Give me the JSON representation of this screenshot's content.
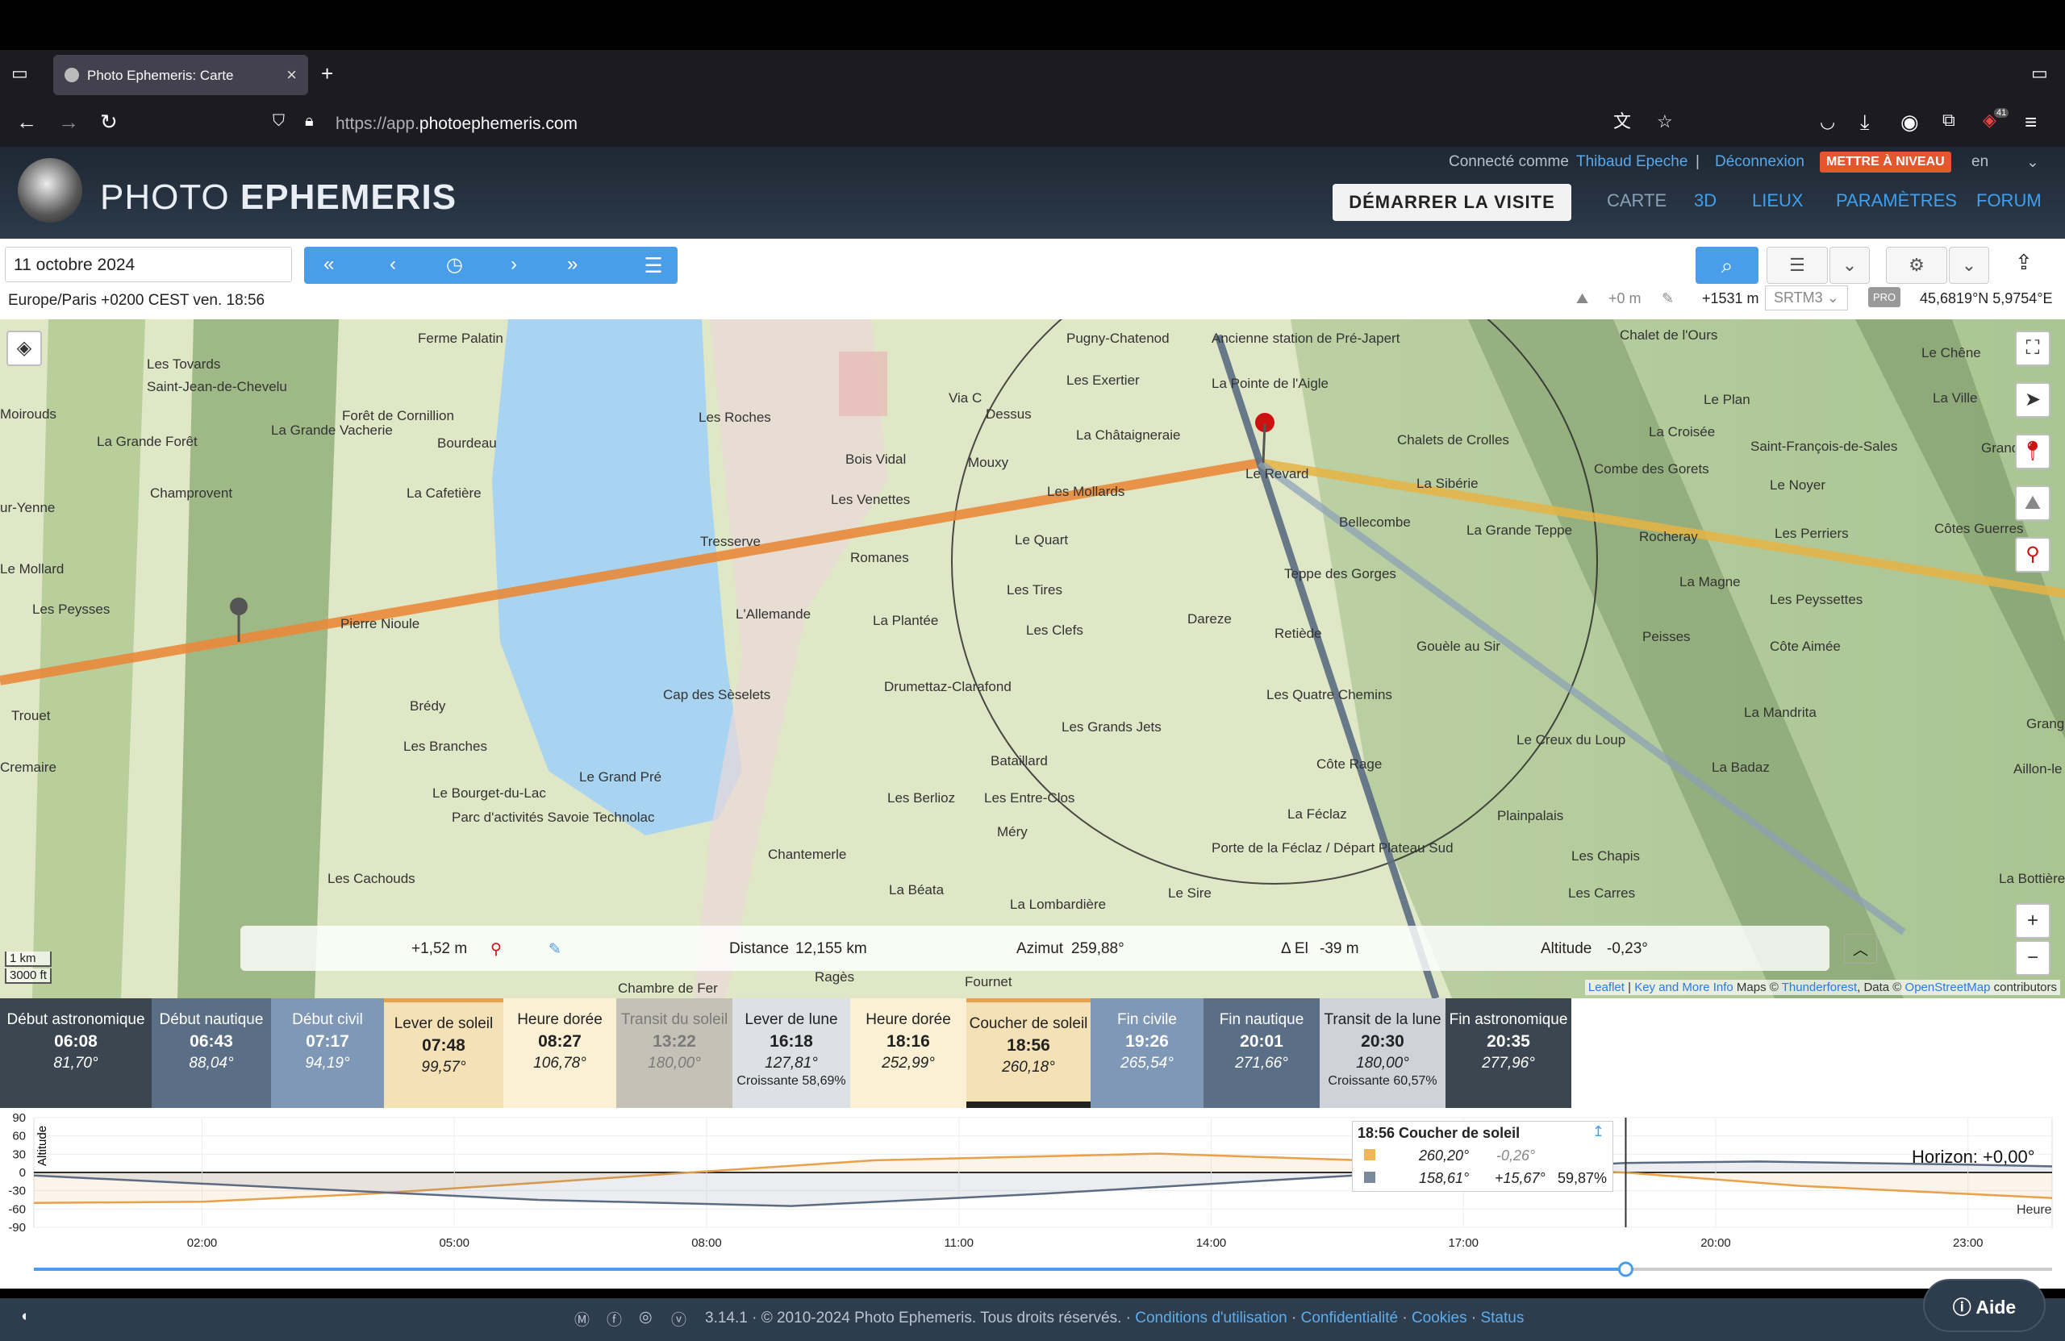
{
  "browser": {
    "tab_title": "Photo Ephemeris: Carte",
    "url_prefix": "https://app.",
    "url_domain": "photoephemeris.com",
    "notif_count": "41"
  },
  "header": {
    "logo_light": "PHOTO ",
    "logo_bold": "EPHEMERIS",
    "connected_as": "Connecté comme",
    "user": "Thibaud Epeche",
    "sep": "|",
    "logout": "Déconnexion",
    "upgrade": "METTRE À NIVEAU",
    "lang": "en",
    "tour": "DÉMARRER LA VISITE",
    "nav": [
      "CARTE",
      "3D",
      "LIEUX",
      "PARAMÈTRES",
      "FORUM"
    ]
  },
  "controls": {
    "date": "11 octobre 2024",
    "timezone": "Europe/Paris +0200 CEST ven. 18:56",
    "elev_offset": "+0 m",
    "elevation": "+1531 m",
    "dem": "SRTM3",
    "pro": "PRO",
    "coords": "45,6819°N 5,9754°E"
  },
  "map": {
    "labels": [
      [
        "Ferme Palatin",
        518,
        14
      ],
      [
        "Pugny-Chatenod",
        1322,
        14
      ],
      [
        "Ancienne station de Pré-Japert",
        1502,
        14
      ],
      [
        "Chalet de l'Ours",
        2008,
        10
      ],
      [
        "Les Tovards",
        182,
        46
      ],
      [
        "Saint-Jean-de-Chevelu",
        182,
        74
      ],
      [
        "Forêt de Cornillion",
        424,
        110
      ],
      [
        "Les Exertier",
        1322,
        66
      ],
      [
        "La Pointe de l'Aigle",
        1502,
        70
      ],
      [
        "Le Chêne",
        2382,
        32
      ],
      [
        "Moirouds",
        0,
        108
      ],
      [
        "La Grande Vacherie",
        336,
        128
      ],
      [
        "La Grande Forêt",
        120,
        142
      ],
      [
        "Bourdeau",
        542,
        144
      ],
      [
        "Les Roches",
        866,
        112
      ],
      [
        "Via C",
        1176,
        88
      ],
      [
        "Dessus",
        1222,
        108
      ],
      [
        "Le Plan",
        2112,
        90
      ],
      [
        "La Ville",
        2396,
        88
      ],
      [
        "La Châtaigneraie",
        1334,
        134
      ],
      [
        "Chalets de Crolles",
        1732,
        140
      ],
      [
        "La Croisée",
        2044,
        130
      ],
      [
        "Saint-François-de-Sales",
        2170,
        148
      ],
      [
        "Grandes C",
        2456,
        150
      ],
      [
        "Champrovent",
        186,
        206
      ],
      [
        "La Cafetière",
        504,
        206
      ],
      [
        "Bois Vidal",
        1048,
        164
      ],
      [
        "Mouxy",
        1200,
        168
      ],
      [
        "Le Revard",
        1544,
        182
      ],
      [
        "La Sibérie",
        1756,
        194
      ],
      [
        "Combe des Gorets",
        1976,
        176
      ],
      [
        "Le Noyer",
        2194,
        196
      ],
      [
        "ur-Yenne",
        0,
        224
      ],
      [
        "Les Venettes",
        1030,
        214
      ],
      [
        "Les Mollards",
        1298,
        204
      ],
      [
        "Bellecombe",
        1660,
        242
      ],
      [
        "La Grande Teppe",
        1818,
        252
      ],
      [
        "Rocheray",
        2032,
        260
      ],
      [
        "Les Perriers",
        2200,
        256
      ],
      [
        "Côtes Guerres",
        2398,
        250
      ],
      [
        "Le Quart",
        1258,
        264
      ],
      [
        "Romanes",
        1054,
        286
      ],
      [
        "Tresserve",
        868,
        266
      ],
      [
        "Le Mollard",
        0,
        300
      ],
      [
        "Teppe des Gorges",
        1592,
        306
      ],
      [
        "La Magne",
        2082,
        316
      ],
      [
        "Les Peysses",
        40,
        350
      ],
      [
        "L'Allemande",
        912,
        356
      ],
      [
        "Les Tires",
        1248,
        326
      ],
      [
        "La Plantée",
        1082,
        364
      ],
      [
        "Dareze",
        1472,
        362
      ],
      [
        "Retiède",
        1580,
        380
      ],
      [
        "Les Peyssettes",
        2194,
        338
      ],
      [
        "Pierre Nioule",
        422,
        368
      ],
      [
        "Les Clefs",
        1272,
        376
      ],
      [
        "Peisses",
        2036,
        384
      ],
      [
        "Gouèle au Sir",
        1756,
        396
      ],
      [
        "Côte Aimée",
        2194,
        396
      ],
      [
        "Trouet",
        14,
        482
      ],
      [
        "Cap des Sèselets",
        822,
        456
      ],
      [
        "Drumettaz-Clarafond",
        1096,
        446
      ],
      [
        "Les Quatre Chemins",
        1570,
        456
      ],
      [
        "La Mandrita",
        2162,
        478
      ],
      [
        "Grang",
        2512,
        492
      ],
      [
        "Brédy",
        508,
        470
      ],
      [
        "Les Branches",
        500,
        520
      ],
      [
        "Les Grands Jets",
        1316,
        496
      ],
      [
        "Le Creux du Loup",
        1880,
        512
      ],
      [
        "Cremaire",
        0,
        546
      ],
      [
        "Le Grand Pré",
        718,
        558
      ],
      [
        "Le Bourget-du-Lac",
        536,
        578
      ],
      [
        "Bataillard",
        1228,
        538
      ],
      [
        "Côte Rage",
        1632,
        542
      ],
      [
        "La Badaz",
        2122,
        546
      ],
      [
        "Aillon-le",
        2496,
        548
      ],
      [
        "Parc d'activités Savoie Technolac",
        560,
        608
      ],
      [
        "Les Berlioz",
        1100,
        584
      ],
      [
        "Les Entre-Clos",
        1220,
        584
      ],
      [
        "Méry",
        1236,
        626
      ],
      [
        "La Féclaz",
        1596,
        604
      ],
      [
        "Plainpalais",
        1856,
        606
      ],
      [
        "Chantemerle",
        952,
        654
      ],
      [
        "Porte de la Féclaz / Départ Plateau Sud",
        1502,
        646
      ],
      [
        "Les Chapis",
        1948,
        656
      ],
      [
        "Les Cachouds",
        406,
        684
      ],
      [
        "La Béata",
        1102,
        698
      ],
      [
        "Le Sire",
        1448,
        702
      ],
      [
        "Les Carres",
        1944,
        702
      ],
      [
        "La Bottière",
        2478,
        684
      ],
      [
        "La Lombardière",
        1252,
        716
      ],
      [
        "Chambre de Fer",
        766,
        820
      ],
      [
        "Ragès",
        1010,
        806
      ],
      [
        "Fournet",
        1196,
        812
      ]
    ]
  },
  "infobar": {
    "elev": "+1,52 m",
    "distance_label": "Distance",
    "distance": "12,155 km",
    "azimuth_label": "Azimut",
    "azimuth": "259,88°",
    "delta_el_label": "Δ El",
    "delta_el": "-39 m",
    "altitude_label": "Altitude",
    "altitude": "-0,23°"
  },
  "scale": {
    "km": "1 km",
    "ft": "3000 ft"
  },
  "attribution": {
    "leaflet": "Leaflet",
    "sep": " | ",
    "key": "Key and More Info",
    "maps": " Maps © ",
    "thunder": "Thunderforest",
    "data": ", Data © ",
    "osm": "OpenStreetMap",
    "contrib": " contributors"
  },
  "events": [
    {
      "name": "Début astronomique",
      "time": "06:08",
      "az": "81,70°",
      "bg": "#3c4650",
      "fg": "#ffffff"
    },
    {
      "name": "Début nautique",
      "time": "06:43",
      "az": "88,04°",
      "bg": "#5a6e86",
      "fg": "#ffffff"
    },
    {
      "name": "Début civil",
      "time": "07:17",
      "az": "94,19°",
      "bg": "#7f98b6",
      "fg": "#ffffff"
    },
    {
      "name": "Lever de soleil",
      "time": "07:48",
      "az": "99,57°",
      "bg": "#f4e1b6",
      "fg": "#222222"
    },
    {
      "name": "Heure dorée",
      "time": "08:27",
      "az": "106,78°",
      "bg": "#fbf0d4",
      "fg": "#222222"
    },
    {
      "name": "Transit du soleil",
      "time": "13:22",
      "az": "180,00°",
      "bg": "#c6c1b6",
      "fg": "#7b7b7b"
    },
    {
      "name": "Lever de lune",
      "time": "16:18",
      "az": "127,81°",
      "pct": "Croissante 58,69%",
      "bg": "#dde0e5",
      "fg": "#222222"
    },
    {
      "name": "Heure dorée",
      "time": "18:16",
      "az": "252,99°",
      "bg": "#fbf0d4",
      "fg": "#222222"
    },
    {
      "name": "Coucher de soleil",
      "time": "18:56",
      "az": "260,18°",
      "bg": "#f4e1b6",
      "fg": "#222222"
    },
    {
      "name": "Fin civile",
      "time": "19:26",
      "az": "265,54°",
      "bg": "#7f98b6",
      "fg": "#ffffff"
    },
    {
      "name": "Fin nautique",
      "time": "20:01",
      "az": "271,66°",
      "bg": "#5a6e86",
      "fg": "#ffffff"
    },
    {
      "name": "Transit de la lune",
      "time": "20:30",
      "az": "180,00°",
      "pct": "Croissante 60,57%",
      "bg": "#cfd3d9",
      "fg": "#222222"
    },
    {
      "name": "Fin astronomique",
      "time": "20:35",
      "az": "277,96°",
      "bg": "#3c4650",
      "fg": "#ffffff"
    }
  ],
  "chart": {
    "ylabel": "Altitude",
    "yticks": [
      "90",
      "60",
      "30",
      "0",
      "-30",
      "-60",
      "-90"
    ],
    "xticks": [
      "02:00",
      "05:00",
      "08:00",
      "11:00",
      "14:00",
      "17:00",
      "20:00",
      "23:00"
    ],
    "xunit": "Heure",
    "horizon": "Horizon: +0,00°",
    "tooltip": {
      "title": "18:56 Coucher de soleil",
      "sun_az": "260,20°",
      "sun_alt": "-0,26°",
      "moon_az": "158,61°",
      "moon_alt": "+15,67°",
      "moon_pct": "59,87%"
    },
    "colors": {
      "sun": "#e8a04a",
      "moon": "#5b6c82"
    }
  },
  "chart_data": {
    "type": "line",
    "title": "",
    "xlabel": "Heure",
    "ylabel": "Altitude",
    "xlim": [
      0,
      24
    ],
    "ylim": [
      -90,
      90
    ],
    "series": [
      {
        "name": "",
        "x": [
          0,
          2,
          4,
          6,
          7.8,
          10,
          13.37,
          16,
          18.93,
          21,
          24
        ],
        "y": [
          -50,
          -48,
          -35,
          -17,
          0,
          20,
          31,
          19,
          -0.26,
          -22,
          -42
        ]
      },
      {
        "name": "",
        "x": [
          0,
          3,
          6,
          9,
          12,
          16.3,
          18.93,
          20.5,
          23,
          24
        ],
        "y": [
          -5,
          -25,
          -45,
          -55,
          -35,
          0,
          15.67,
          18,
          13,
          10
        ]
      }
    ]
  },
  "footer": {
    "version": "3.14.1 · © 2010-2024 Photo Ephemeris. Tous droits réservés. · ",
    "terms": "Conditions d'utilisation",
    "privacy": "Confidentialité",
    "cookies": "Cookies",
    "status": "Status",
    "dot": " · ",
    "help": "Aide"
  }
}
